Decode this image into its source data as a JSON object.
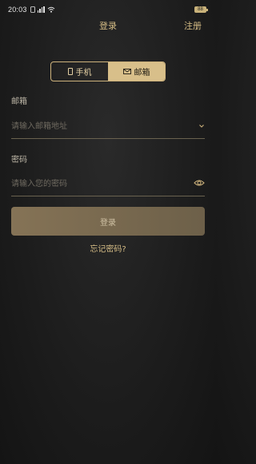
{
  "status_bar": {
    "time": "20:03",
    "battery": "88"
  },
  "header": {
    "title": "登录",
    "register": "注册"
  },
  "tabs": [
    {
      "label": "手机",
      "icon": "phone-icon",
      "selected": false
    },
    {
      "label": "邮箱",
      "icon": "mail-icon",
      "selected": true
    }
  ],
  "email": {
    "label": "邮箱",
    "placeholder": "请输入邮箱地址",
    "value": ""
  },
  "password": {
    "label": "密码",
    "placeholder": "请输入您的密码",
    "value": ""
  },
  "login_label": "登录",
  "forgot_label": "忘记密码?",
  "colors": {
    "accent": "#d8bf8a",
    "background": "#1f1f1f",
    "button": "#7a6a50"
  }
}
